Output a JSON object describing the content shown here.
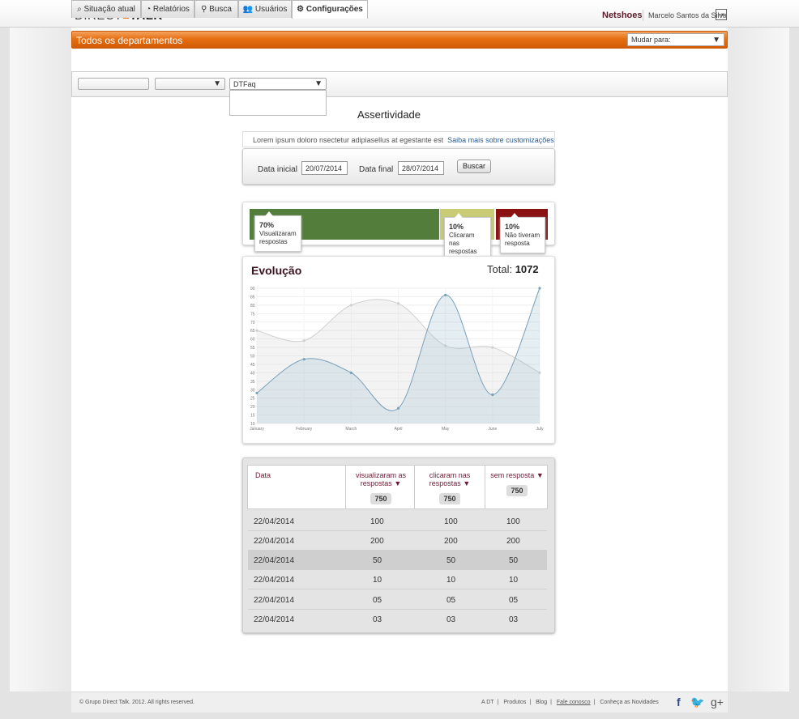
{
  "header": {
    "logo_left": "DIRECT",
    "logo_right": "TALK",
    "brand": "Netshoes",
    "user": "Marcelo Santos da Silva"
  },
  "dept": {
    "title": "Todos os departamentos",
    "switch_label": "Mudar para:"
  },
  "tabs": [
    {
      "label": "Situação atual",
      "icon": "monitor-search-icon"
    },
    {
      "label": "Relatórios",
      "icon": "pie-chart-icon"
    },
    {
      "label": "Busca",
      "icon": "search-icon"
    },
    {
      "label": "Usuários",
      "icon": "users-icon"
    },
    {
      "label": "Configurações",
      "icon": "gear-icon",
      "active": true
    }
  ],
  "filters": {
    "select3_value": "DTFaq"
  },
  "page": {
    "title": "Assertividade",
    "info_text": "Lorem ipsum doloro nsectetur adipiasellus at egestante est",
    "info_link": "Saiba mais sobre customizações",
    "start_label": "Data inicial",
    "start_value": "20/07/2014",
    "end_label": "Data final",
    "end_value": "28/07/2014",
    "search_button": "Buscar"
  },
  "summary": [
    {
      "percent": "70%",
      "label": "Visualizaram respostas",
      "value": 0.7,
      "color": "#527d3a"
    },
    {
      "percent": "10%",
      "label": "Clicaram nas respostas",
      "value": 0.1,
      "color": "#c9cc74"
    },
    {
      "percent": "10%",
      "label": "Não tiveram resposta",
      "value": 0.1,
      "color": "#8b1010"
    }
  ],
  "chart": {
    "title": "Evolução",
    "total_label": "Total:",
    "total_value": "1072"
  },
  "chart_data": {
    "type": "line",
    "categories": [
      "January",
      "February",
      "March",
      "April",
      "May",
      "June",
      "July"
    ],
    "series": [
      {
        "values": [
          65,
          59,
          80,
          81,
          56,
          55,
          40
        ],
        "color": "#cfcfcf"
      },
      {
        "values": [
          28,
          48,
          40,
          19,
          86,
          27,
          90
        ],
        "color": "#7aa0b8"
      }
    ],
    "ylim": [
      10,
      90
    ],
    "yticks": [
      10,
      15,
      20,
      25,
      30,
      35,
      40,
      45,
      50,
      55,
      60,
      65,
      70,
      75,
      80,
      85,
      90
    ],
    "grid": true
  },
  "table": {
    "headers": [
      {
        "label": "Data"
      },
      {
        "label": "visualizaram as respostas",
        "total": "750"
      },
      {
        "label": "clicaram nas respostas",
        "total": "750"
      },
      {
        "label": "sem resposta",
        "total": "750"
      }
    ],
    "rows": [
      [
        "22/04/2014",
        "100",
        "100",
        "100"
      ],
      [
        "22/04/2014",
        "200",
        "200",
        "200"
      ],
      [
        "22/04/2014",
        "50",
        "50",
        "50"
      ],
      [
        "22/04/2014",
        "10",
        "10",
        "10"
      ],
      [
        "22/04/2014",
        "05",
        "05",
        "05"
      ],
      [
        "22/04/2014",
        "03",
        "03",
        "03"
      ]
    ]
  },
  "footer": {
    "copyright": "© Grupo Direct Talk. 2012. All rights reserved.",
    "links": [
      "A DT",
      "Produtos",
      "Blog",
      "Fale conosco",
      "Conheça as Novidades"
    ],
    "social": [
      {
        "name": "facebook-icon",
        "glyph": "f",
        "color": "#2c4a8a"
      },
      {
        "name": "twitter-icon",
        "glyph": "t",
        "color": "#3a9ad6"
      },
      {
        "name": "googleplus-icon",
        "glyph": "g+",
        "color": "#555555"
      }
    ]
  }
}
